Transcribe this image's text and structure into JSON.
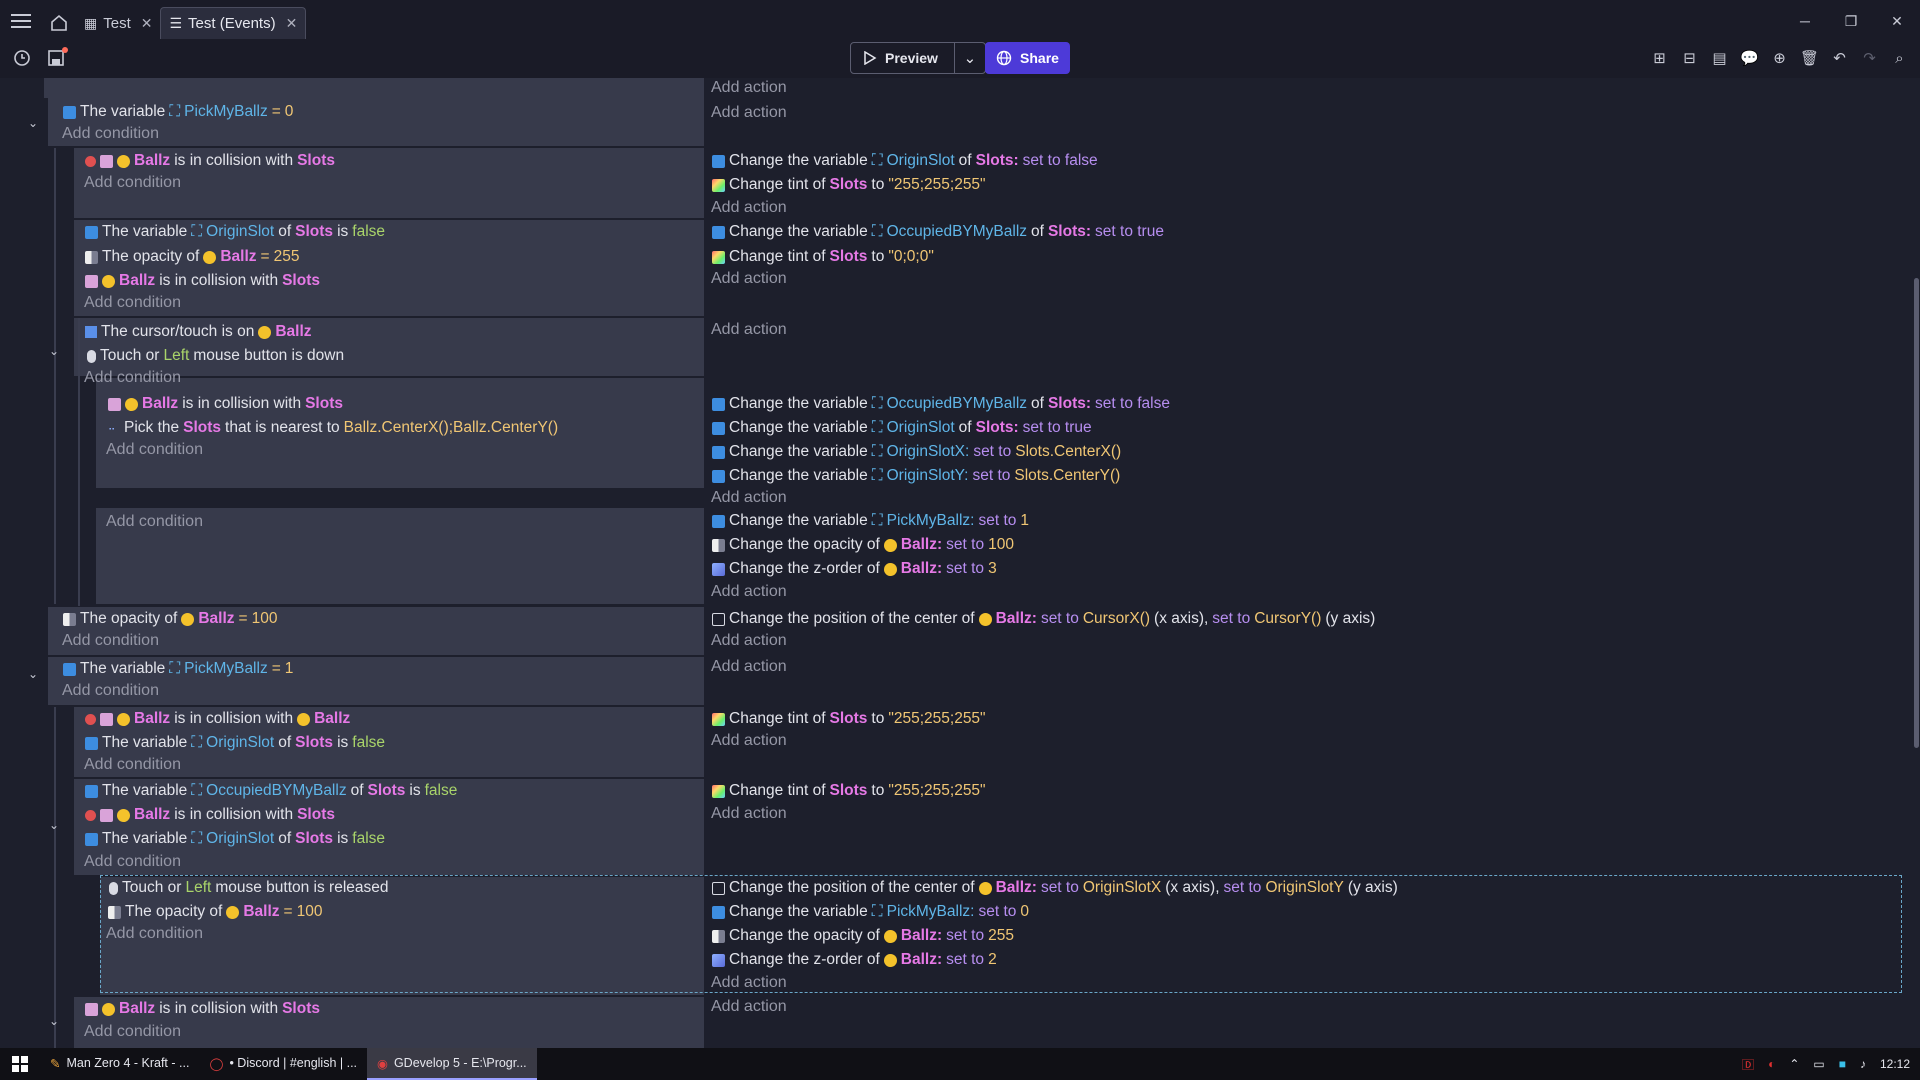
{
  "titlebar": {
    "tabs": [
      {
        "label": "Test"
      },
      {
        "label": "Test (Events)"
      }
    ]
  },
  "toolbar": {
    "preview_label": "Preview",
    "share_label": "Share"
  },
  "events": {
    "add_action": "Add action",
    "add_condition": "Add condition",
    "e1": {
      "c1_pre": "The variable",
      "c1_var": "PickMyBallz",
      "c1_op": "=",
      "c1_val": "0"
    },
    "e2": {
      "c1_obj": "Ballz",
      "c1_mid": "is in collision with",
      "c1_obj2": "Slots",
      "a1_pre": "Change the variable",
      "a1_var": "OriginSlot",
      "a1_of": "of",
      "a1_obj": "Slots:",
      "a1_set": "set to false",
      "a2_pre": "Change tint of",
      "a2_obj": "Slots",
      "a2_to": "to",
      "a2_val": "\"255;255;255\""
    },
    "e3": {
      "c1_pre": "The variable",
      "c1_var": "OriginSlot",
      "c1_of": "of",
      "c1_obj": "Slots",
      "c1_is": "is",
      "c1_val": "false",
      "c2_pre": "The opacity of",
      "c2_obj": "Ballz",
      "c2_op": "=",
      "c2_val": "255",
      "c3_obj": "Ballz",
      "c3_mid": "is in collision with",
      "c3_obj2": "Slots",
      "a1_pre": "Change the variable",
      "a1_var": "OccupiedBYMyBallz",
      "a1_of": "of",
      "a1_obj": "Slots:",
      "a1_set": "set to true",
      "a2_pre": "Change tint of",
      "a2_obj": "Slots",
      "a2_to": "to",
      "a2_val": "\"0;0;0\""
    },
    "e4": {
      "c1_pre": "The cursor/touch is on",
      "c1_obj": "Ballz",
      "c2_pre": "Touch or",
      "c2_kw": "Left",
      "c2_post": "mouse button is down"
    },
    "e5": {
      "c1_obj": "Ballz",
      "c1_mid": "is in collision with",
      "c1_obj2": "Slots",
      "c2_pre": "Pick the",
      "c2_obj": "Slots",
      "c2_mid": "that is nearest to",
      "c2_val": "Ballz.CenterX();Ballz.CenterY()",
      "a1_pre": "Change the variable",
      "a1_var": "OccupiedBYMyBallz",
      "a1_of": "of",
      "a1_obj": "Slots:",
      "a1_set": "set to false",
      "a2_pre": "Change the variable",
      "a2_var": "OriginSlot",
      "a2_of": "of",
      "a2_obj": "Slots:",
      "a2_set": "set to true",
      "a3_pre": "Change the variable",
      "a3_var": "OriginSlotX:",
      "a3_set": "set to",
      "a3_val": "Slots.CenterX()",
      "a4_pre": "Change the variable",
      "a4_var": "OriginSlotY:",
      "a4_set": "set to",
      "a4_val": "Slots.CenterY()"
    },
    "e6": {
      "a1_pre": "Change the variable",
      "a1_var": "PickMyBallz:",
      "a1_set": "set to",
      "a1_val": "1",
      "a2_pre": "Change the opacity of",
      "a2_obj": "Ballz:",
      "a2_set": "set to",
      "a2_val": "100",
      "a3_pre": "Change the z-order of",
      "a3_obj": "Ballz:",
      "a3_set": "set to",
      "a3_val": "3"
    },
    "e7": {
      "c1_pre": "The opacity of",
      "c1_obj": "Ballz",
      "c1_op": "=",
      "c1_val": "100",
      "a1_pre": "Change the position of the center of",
      "a1_obj": "Ballz:",
      "a1_set": "set to",
      "a1_val": "CursorX()",
      "a1_x": "(x axis),",
      "a1_set2": "set to",
      "a1_val2": "CursorY()",
      "a1_y": "(y axis)"
    },
    "e8": {
      "c1_pre": "The variable",
      "c1_var": "PickMyBallz",
      "c1_op": "=",
      "c1_val": "1"
    },
    "e9": {
      "c1_obj": "Ballz",
      "c1_mid": "is in collision with",
      "c1_obj2": "Ballz",
      "c2_pre": "The variable",
      "c2_var": "OriginSlot",
      "c2_of": "of",
      "c2_obj": "Slots",
      "c2_is": "is",
      "c2_val": "false",
      "a1_pre": "Change tint of",
      "a1_obj": "Slots",
      "a1_to": "to",
      "a1_val": "\"255;255;255\""
    },
    "e10": {
      "c1_pre": "The variable",
      "c1_var": "OccupiedBYMyBallz",
      "c1_of": "of",
      "c1_obj": "Slots",
      "c1_is": "is",
      "c1_val": "false",
      "c2_obj": "Ballz",
      "c2_mid": "is in collision with",
      "c2_obj2": "Slots",
      "c3_pre": "The variable",
      "c3_var": "OriginSlot",
      "c3_of": "of",
      "c3_obj": "Slots",
      "c3_is": "is",
      "c3_val": "false",
      "a1_pre": "Change tint of",
      "a1_obj": "Slots",
      "a1_to": "to",
      "a1_val": "\"255;255;255\""
    },
    "e11": {
      "c1_pre": "Touch or",
      "c1_kw": "Left",
      "c1_post": "mouse button is released",
      "c2_pre": "The opacity of",
      "c2_obj": "Ballz",
      "c2_op": "=",
      "c2_val": "100",
      "a1_pre": "Change the position of the center of",
      "a1_obj": "Ballz:",
      "a1_set": "set to",
      "a1_val": "OriginSlotX",
      "a1_x": "(x axis),",
      "a1_set2": "set to",
      "a1_val2": "OriginSlotY",
      "a1_y": "(y axis)",
      "a2_pre": "Change the variable",
      "a2_var": "PickMyBallz:",
      "a2_set": "set to",
      "a2_val": "0",
      "a3_pre": "Change the opacity of",
      "a3_obj": "Ballz:",
      "a3_set": "set to",
      "a3_val": "255",
      "a4_pre": "Change the z-order of",
      "a4_obj": "Ballz:",
      "a4_set": "set to",
      "a4_val": "2"
    },
    "e12": {
      "c1_obj": "Ballz",
      "c1_mid": "is in collision with",
      "c1_obj2": "Slots"
    }
  },
  "taskbar": {
    "items": [
      {
        "label": "Man Zero 4 - Kraft - ..."
      },
      {
        "label": "• Discord | #english | ..."
      },
      {
        "label": "GDevelop 5 - E:\\Progr..."
      }
    ],
    "clock": "12:12"
  }
}
